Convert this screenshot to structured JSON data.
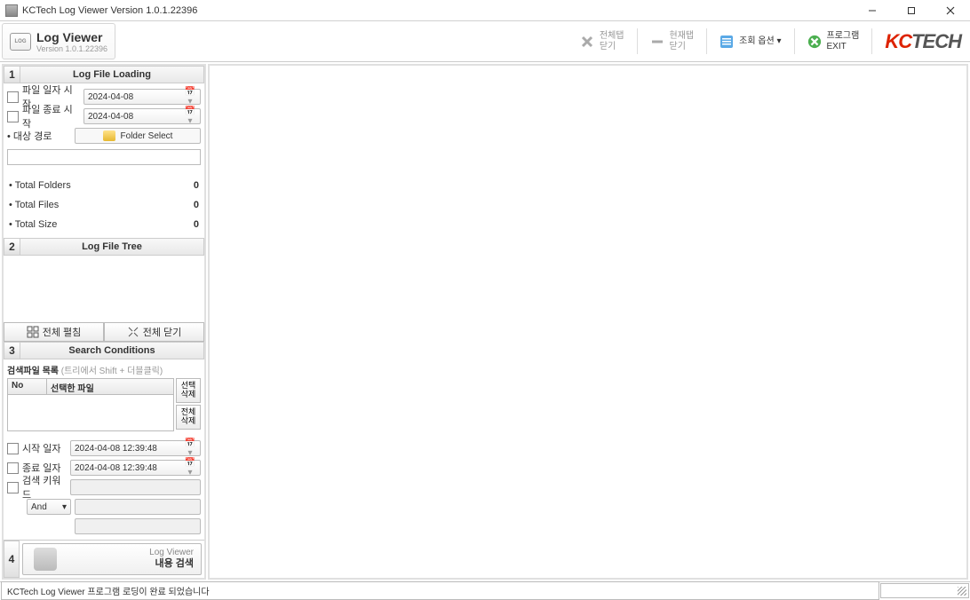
{
  "window": {
    "title": "KCTech Log Viewer Version 1.0.1.22396"
  },
  "ribbon": {
    "logo_title": "Log Viewer",
    "logo_sub": "Version 1.0.1.22396",
    "close_all_tabs": "전체탭\n닫기",
    "close_current_tab": "현재탭\n닫기",
    "view_options": "조회 옵션 ▾",
    "exit": "프로그램\nEXIT"
  },
  "sections": {
    "s1": {
      "num": "1",
      "title": "Log File Loading"
    },
    "s2": {
      "num": "2",
      "title": "Log File Tree"
    },
    "s3": {
      "num": "3",
      "title": "Search Conditions"
    },
    "s4": {
      "num": "4"
    }
  },
  "loading": {
    "start_date_label": "파일 일자 시작",
    "end_date_label": "파일 종료 시작",
    "start_date": "2024-04-08",
    "end_date": "2024-04-08",
    "path_label": "대상 경로",
    "folder_select": "Folder Select",
    "total_folders_label": "Total Folders",
    "total_files_label": "Total Files",
    "total_size_label": "Total Size",
    "total_folders": "0",
    "total_files": "0",
    "total_size": "0"
  },
  "tree": {
    "expand_all": "전체 펼침",
    "collapse_all": "전체 닫기"
  },
  "search": {
    "file_list_label": "검색파일 목록",
    "file_list_hint": "(트리에서 Shift + 더블클릭)",
    "col_no": "No",
    "col_file": "선택한 파일",
    "btn_sel_del": "선택\n삭제",
    "btn_all_del": "전체\n삭제",
    "start_label": "시작 일자",
    "end_label": "종료 일자",
    "keyword_label": "검색 키워드",
    "start_dt": "2024-04-08 12:39:48",
    "end_dt": "2024-04-08 12:39:48",
    "combo": "And"
  },
  "sec4": {
    "title": "Log Viewer",
    "sub": "내용 검색"
  },
  "status": {
    "text": "KCTech Log Viewer 프로그램 로딩이 완료 되었습니다"
  }
}
